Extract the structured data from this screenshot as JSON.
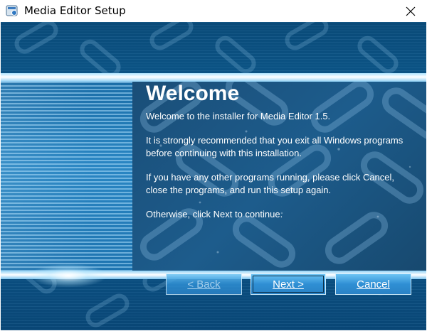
{
  "window": {
    "title": "Media Editor Setup"
  },
  "icons": {
    "app": "installer-icon",
    "close": "close-icon"
  },
  "content": {
    "heading": "Welcome",
    "paragraphs": [
      "Welcome to the installer for Media Editor 1.5.",
      "It is strongly recommended that you exit all Windows programs before continuing with this installation.",
      "If you have any other programs running, please click Cancel, close the programs, and run this setup again.",
      "Otherwise, click Next to continue."
    ]
  },
  "buttons": {
    "back": "< Back",
    "next": "Next >",
    "cancel": "Cancel"
  },
  "colors": {
    "background_blue": "#0d5d92",
    "button_blue": "#2f8fd4",
    "text": "#ffffff"
  }
}
